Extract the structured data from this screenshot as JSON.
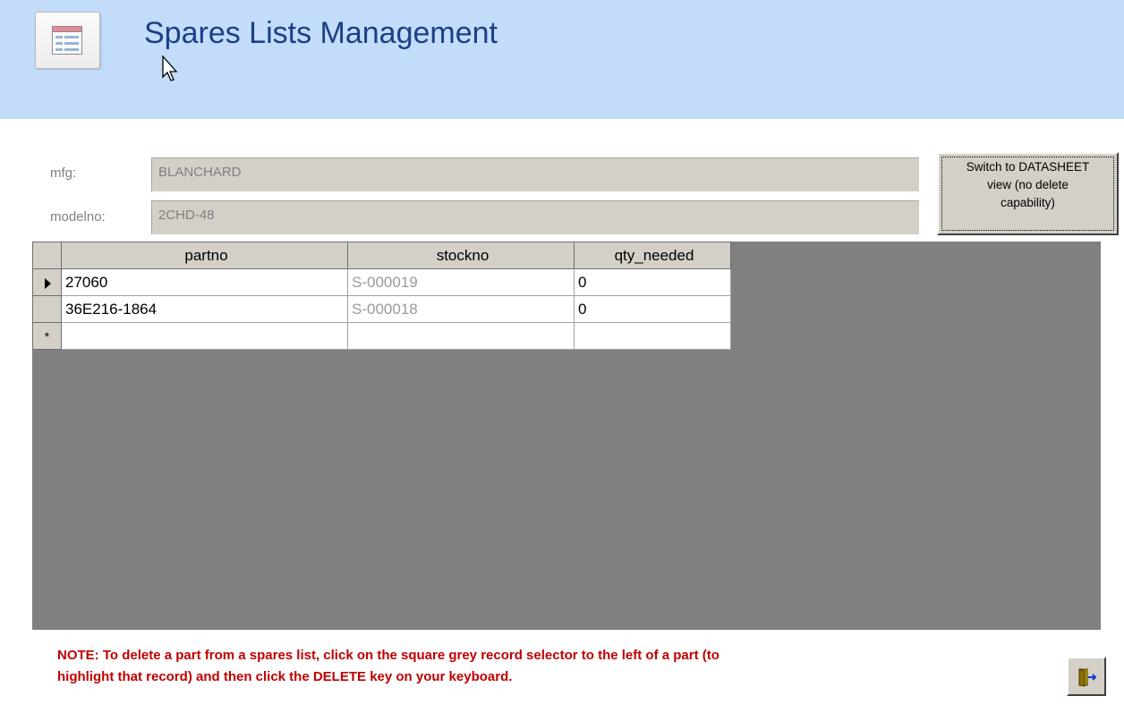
{
  "header": {
    "title": "Spares Lists Management",
    "icon": "form-icon"
  },
  "fields": {
    "mfg": {
      "label": "mfg:",
      "value": "BLANCHARD"
    },
    "modelno": {
      "label": "modelno:",
      "value": "2CHD-48"
    }
  },
  "switch_button": {
    "line1": "Switch to DATASHEET",
    "line2": "view (no delete",
    "line3": "capability)"
  },
  "datasheet": {
    "columns": [
      "partno",
      "stockno",
      "qty_needed"
    ],
    "rows": [
      {
        "selector": "current-record-arrow",
        "partno": "27060",
        "stockno": "S-000019",
        "qty_needed": "0"
      },
      {
        "selector": "",
        "partno": "36E216-1864",
        "stockno": "S-000018",
        "qty_needed": "0"
      }
    ],
    "new_row_selector": "*"
  },
  "note": {
    "line1": "NOTE: To delete a part from a spares list, click on the square grey record selector to the left of a part (to",
    "line2": "highlight that record) and then click the DELETE key on your keyboard."
  },
  "exit_button": {
    "icon": "exit-door-icon"
  },
  "colors": {
    "header_bg": "#c2dcfa",
    "title": "#1c3f86",
    "note": "#c00000",
    "sheet_bg": "#808080",
    "control_face": "#d4d0c8"
  }
}
